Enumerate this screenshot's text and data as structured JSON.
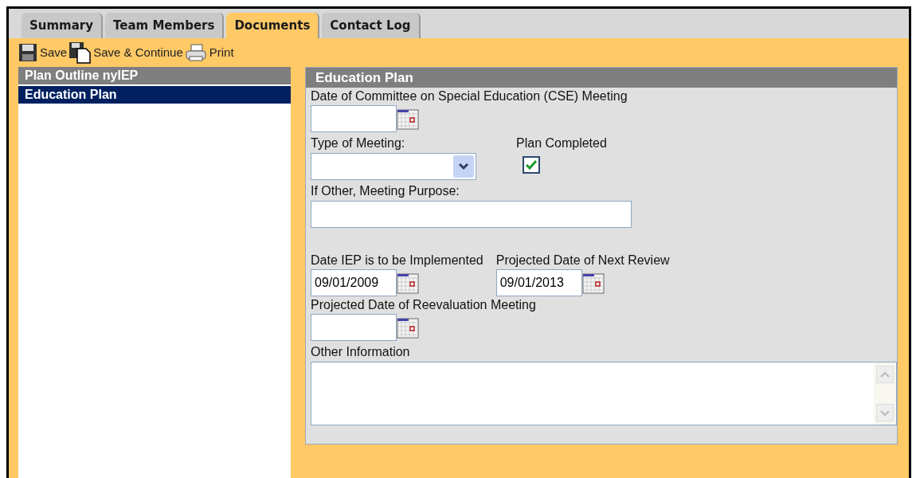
{
  "tabs": [
    {
      "label": "Summary",
      "selected": false
    },
    {
      "label": "Team Members",
      "selected": false
    },
    {
      "label": "Documents",
      "selected": true
    },
    {
      "label": "Contact Log",
      "selected": false
    }
  ],
  "toolbar": [
    {
      "kind": "save",
      "label": "Save"
    },
    {
      "kind": "save-continue",
      "label": "Save & Continue"
    },
    {
      "kind": "print",
      "label": "Print"
    }
  ],
  "outline": {
    "title": "Plan Outline nyIEP",
    "items": [
      {
        "label": "Education Plan",
        "selected": true
      }
    ]
  },
  "form": {
    "title": "Education Plan",
    "cse_meeting_date": {
      "label": "Date of Committee on Special Education (CSE) Meeting"
    },
    "meeting_type": {
      "label": "Type of Meeting:"
    },
    "plan_completed": {
      "label": "Plan Completed",
      "checked": true
    },
    "meeting_purpose": {
      "label": "If Other, Meeting Purpose:"
    },
    "implement_date": {
      "label": "Date IEP is to be Implemented",
      "value": "09/01/2009"
    },
    "next_review_date": {
      "label": "Projected Date of Next Review",
      "value": "09/01/2013"
    },
    "reevaluation_date": {
      "label": "Projected Date of Reevaluation Meeting"
    },
    "other_information": {
      "label": "Other Information"
    }
  }
}
